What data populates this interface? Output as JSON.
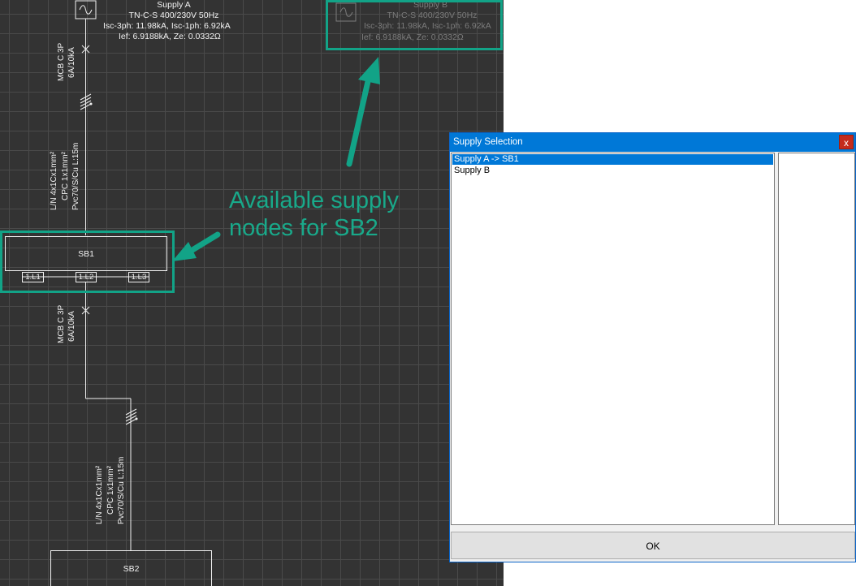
{
  "supply_a": {
    "name": "Supply A",
    "system": "TN-C-S 400/230V 50Hz",
    "isc": "Isc-3ph: 11.98kA, Isc-1ph: 6.92kA",
    "ief": "Ief: 6.9188kA, Ze: 0.0332Ω"
  },
  "supply_b": {
    "name": "Supply B",
    "system": "TN-C-S 400/230V 50Hz",
    "isc": "Isc-3ph: 11.98kA, Isc-1ph: 6.92kA",
    "ief": "Ief: 6.9188kA, Ze: 0.0332Ω"
  },
  "breaker1": {
    "type": "MCB C 3P",
    "rating": "6A/10kA"
  },
  "cable1": {
    "line1": "L/N 4x1Cx1mm²",
    "line2": "CPC 1x1mm²",
    "line3": "Pvc70/S/Cu L:15m"
  },
  "sb1": {
    "name": "SB1",
    "phases": [
      "1.L1",
      "1.L2",
      "1.L3"
    ]
  },
  "breaker2": {
    "type": "MCB C 3P",
    "rating": "6A/10kA"
  },
  "cable2": {
    "line1": "L/N 4x1Cx1mm²",
    "line2": "CPC 1x1mm²",
    "line3": "Pvc70/S/Cu L:15m"
  },
  "sb2": {
    "name": "SB2"
  },
  "annotation": {
    "text": "Available supply nodes for SB2",
    "color": "#19a98a"
  },
  "dialog": {
    "title": "Supply Selection",
    "close_label": "x",
    "items": [
      {
        "label": "Supply A -> SB1",
        "selected": true
      },
      {
        "label": "Supply B",
        "selected": false
      }
    ],
    "ok_label": "OK"
  },
  "icons": [
    "ac-source-icon",
    "breaker-x-icon",
    "cable-tick-icon",
    "arrow-icon",
    "close-icon"
  ]
}
